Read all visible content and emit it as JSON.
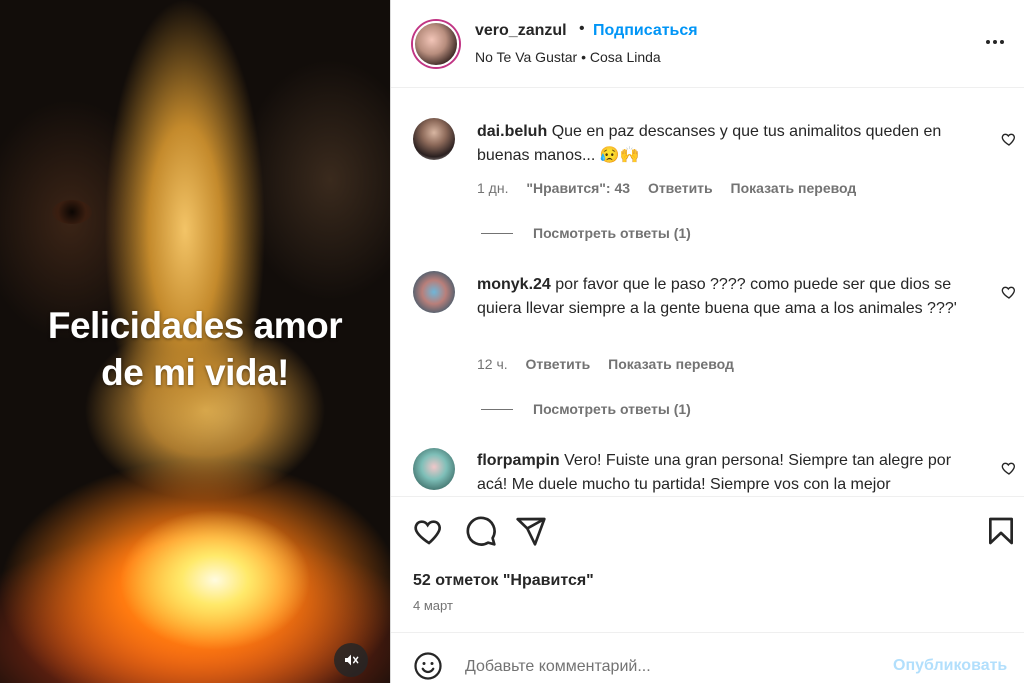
{
  "media": {
    "caption_line1": "Felicidades amor",
    "caption_line2": "de mi vida!"
  },
  "header": {
    "username": "vero_zanzul",
    "separator": "•",
    "follow_label": "Подписаться",
    "music": "No Te Va Gustar • Cosa Linda"
  },
  "comments": [
    {
      "username": "dai.beluh",
      "text": "Que en paz descanses y que tus animalitos queden en buenas manos... 😥🙌",
      "time": "1 дн.",
      "likes": "\"Нравится\": 43",
      "reply": "Ответить",
      "translate": "Показать перевод",
      "view_replies": "Посмотреть ответы (1)"
    },
    {
      "username": "monyk.24",
      "text": "por favor que le paso ???? como puede ser que dios se quiera llevar siempre a la gente buena que ama a los animales ???'",
      "time": "12 ч.",
      "reply": "Ответить",
      "translate": "Показать перевод",
      "view_replies": "Посмотреть ответы (1)"
    },
    {
      "username": "florpampin",
      "text": "Vero! Fuiste una gran persona! Siempre tan alegre por acá! Me duele mucho tu partida! Siempre vos con la mejor"
    }
  ],
  "actions": {
    "likes_count": "52 отметок \"Нравится\"",
    "date": "4 март"
  },
  "add_comment": {
    "placeholder": "Добавьте комментарий...",
    "publish_label": "Опубликовать"
  }
}
